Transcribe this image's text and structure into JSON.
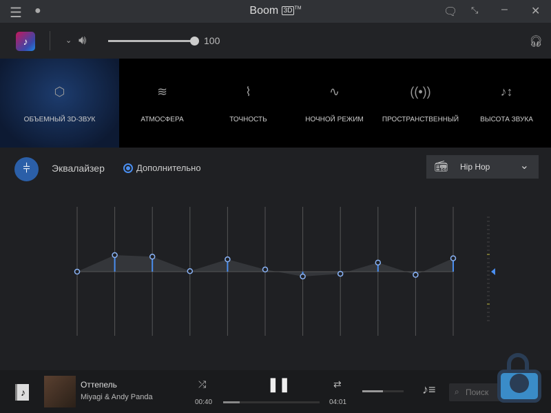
{
  "app": {
    "title": "Boom",
    "title_badge": "3D",
    "title_tm": "TM"
  },
  "toolbar": {
    "volume": 100,
    "volume_label": "100"
  },
  "effects": [
    {
      "label": "ОБЪЕМНЫЙ 3D-ЗВУК",
      "icon": "cube-icon",
      "active": true
    },
    {
      "label": "АТМОСФЕРА",
      "icon": "waves-icon"
    },
    {
      "label": "ТОЧНОСТЬ",
      "icon": "pulse-icon"
    },
    {
      "label": "НОЧНОЙ РЕЖИМ",
      "icon": "night-wave-icon"
    },
    {
      "label": "ПРОСТРАНСТВЕННЫЙ",
      "icon": "spatial-icon"
    },
    {
      "label": "ВЫСОТА ЗВУКА",
      "icon": "pitch-icon"
    }
  ],
  "equalizer": {
    "label": "Эквалайзер",
    "advanced_label": "Дополнительно",
    "advanced_checked": true,
    "preset": "Hip Hop",
    "gains_db": [
      0,
      3.1,
      2.8,
      0.1,
      2.3,
      0.4,
      -0.9,
      -0.4,
      1.7,
      -0.6,
      2.5
    ],
    "range_db": 12,
    "accent": "#4a8ef0"
  },
  "player": {
    "track": "Оттепель",
    "artist": "Miyagi & Andy Panda",
    "elapsed": "00:40",
    "duration": "04:01",
    "progress": 0.17,
    "volume": 0.5,
    "search_placeholder": "Поиск"
  }
}
